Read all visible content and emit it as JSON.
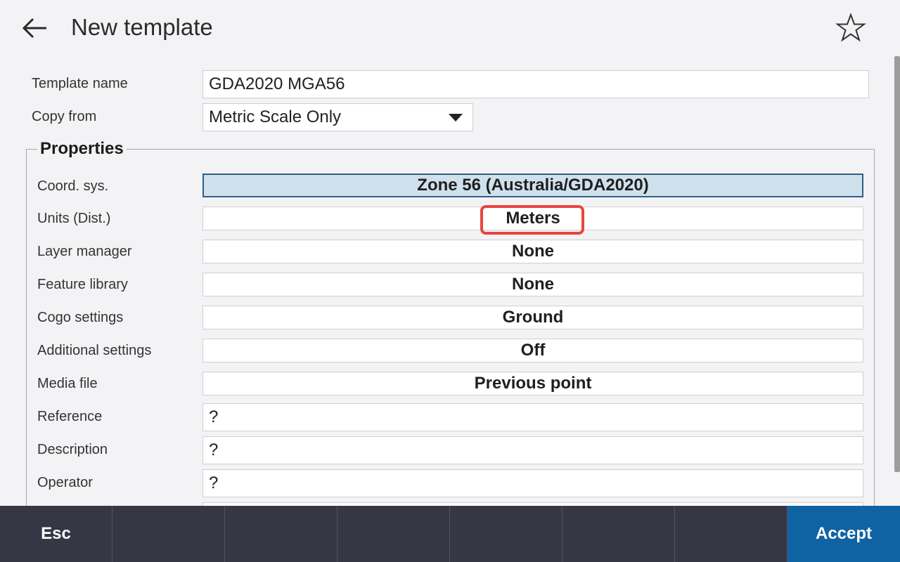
{
  "header": {
    "title": "New template"
  },
  "template_name": {
    "label": "Template name",
    "value": "GDA2020 MGA56"
  },
  "copy_from": {
    "label": "Copy from",
    "value": "Metric Scale Only"
  },
  "properties": {
    "legend": "Properties",
    "rows": [
      {
        "label": "Coord. sys.",
        "value": "Zone 56 (Australia/GDA2020)"
      },
      {
        "label": "Units (Dist.)",
        "value": "Meters"
      },
      {
        "label": "Layer manager",
        "value": "None"
      },
      {
        "label": "Feature library",
        "value": "None"
      },
      {
        "label": "Cogo settings",
        "value": "Ground"
      },
      {
        "label": "Additional settings",
        "value": "Off"
      },
      {
        "label": "Media file",
        "value": "Previous point"
      },
      {
        "label": "Reference",
        "value": "?"
      },
      {
        "label": "Description",
        "value": "?"
      },
      {
        "label": "Operator",
        "value": "?"
      }
    ]
  },
  "footer": {
    "esc_label": "Esc",
    "accept_label": "Accept"
  },
  "colors": {
    "highlight": "#e8453c",
    "accent": "#0f63a3",
    "footer_bg": "#363645",
    "selected_bg": "#cfe1ed"
  }
}
